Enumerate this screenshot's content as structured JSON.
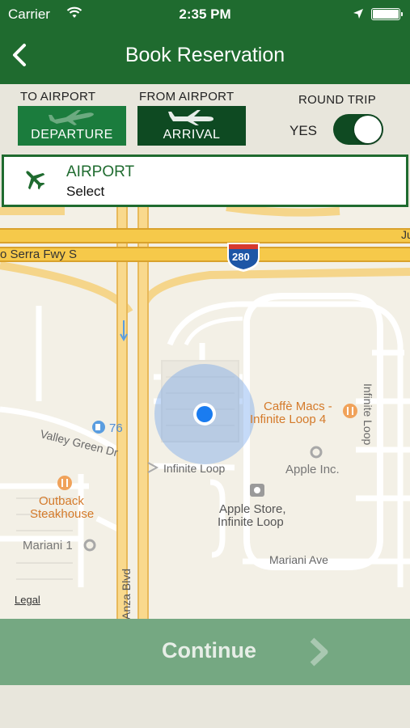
{
  "status_bar": {
    "carrier": "Carrier",
    "time": "2:35 PM"
  },
  "nav": {
    "title": "Book Reservation"
  },
  "options": {
    "to_airport_label": "TO AIRPORT",
    "from_airport_label": "FROM AIRPORT",
    "departure_label": "DEPARTURE",
    "arrival_label": "ARRIVAL",
    "round_trip_label": "ROUND TRIP",
    "round_trip_value": "YES",
    "round_trip_on": true
  },
  "airport": {
    "heading": "AIRPORT",
    "value": "Select"
  },
  "map": {
    "roads": [
      "Ju",
      "o Serra Fwy S",
      "Valley Green Dr",
      "Infinite Loop",
      "Infinite Loop",
      "Mariani Ave",
      "Anza Blvd"
    ],
    "shield": "280",
    "gas_price": "76",
    "pois": {
      "caffe": [
        "Caffè Macs -",
        "Infinite Loop 4"
      ],
      "apple_inc": "Apple Inc.",
      "apple_store": [
        "Apple Store,",
        "Infinite Loop"
      ],
      "outback": [
        "Outback",
        "Steakhouse"
      ],
      "mariani": "Mariani 1"
    },
    "legal": "Legal"
  },
  "footer": {
    "continue_label": "Continue"
  },
  "colors": {
    "brand_green": "#1f6b2f",
    "dark_green": "#0e4a22",
    "continue_green": "#75a882",
    "highway_yellow": "#f6c94a"
  }
}
